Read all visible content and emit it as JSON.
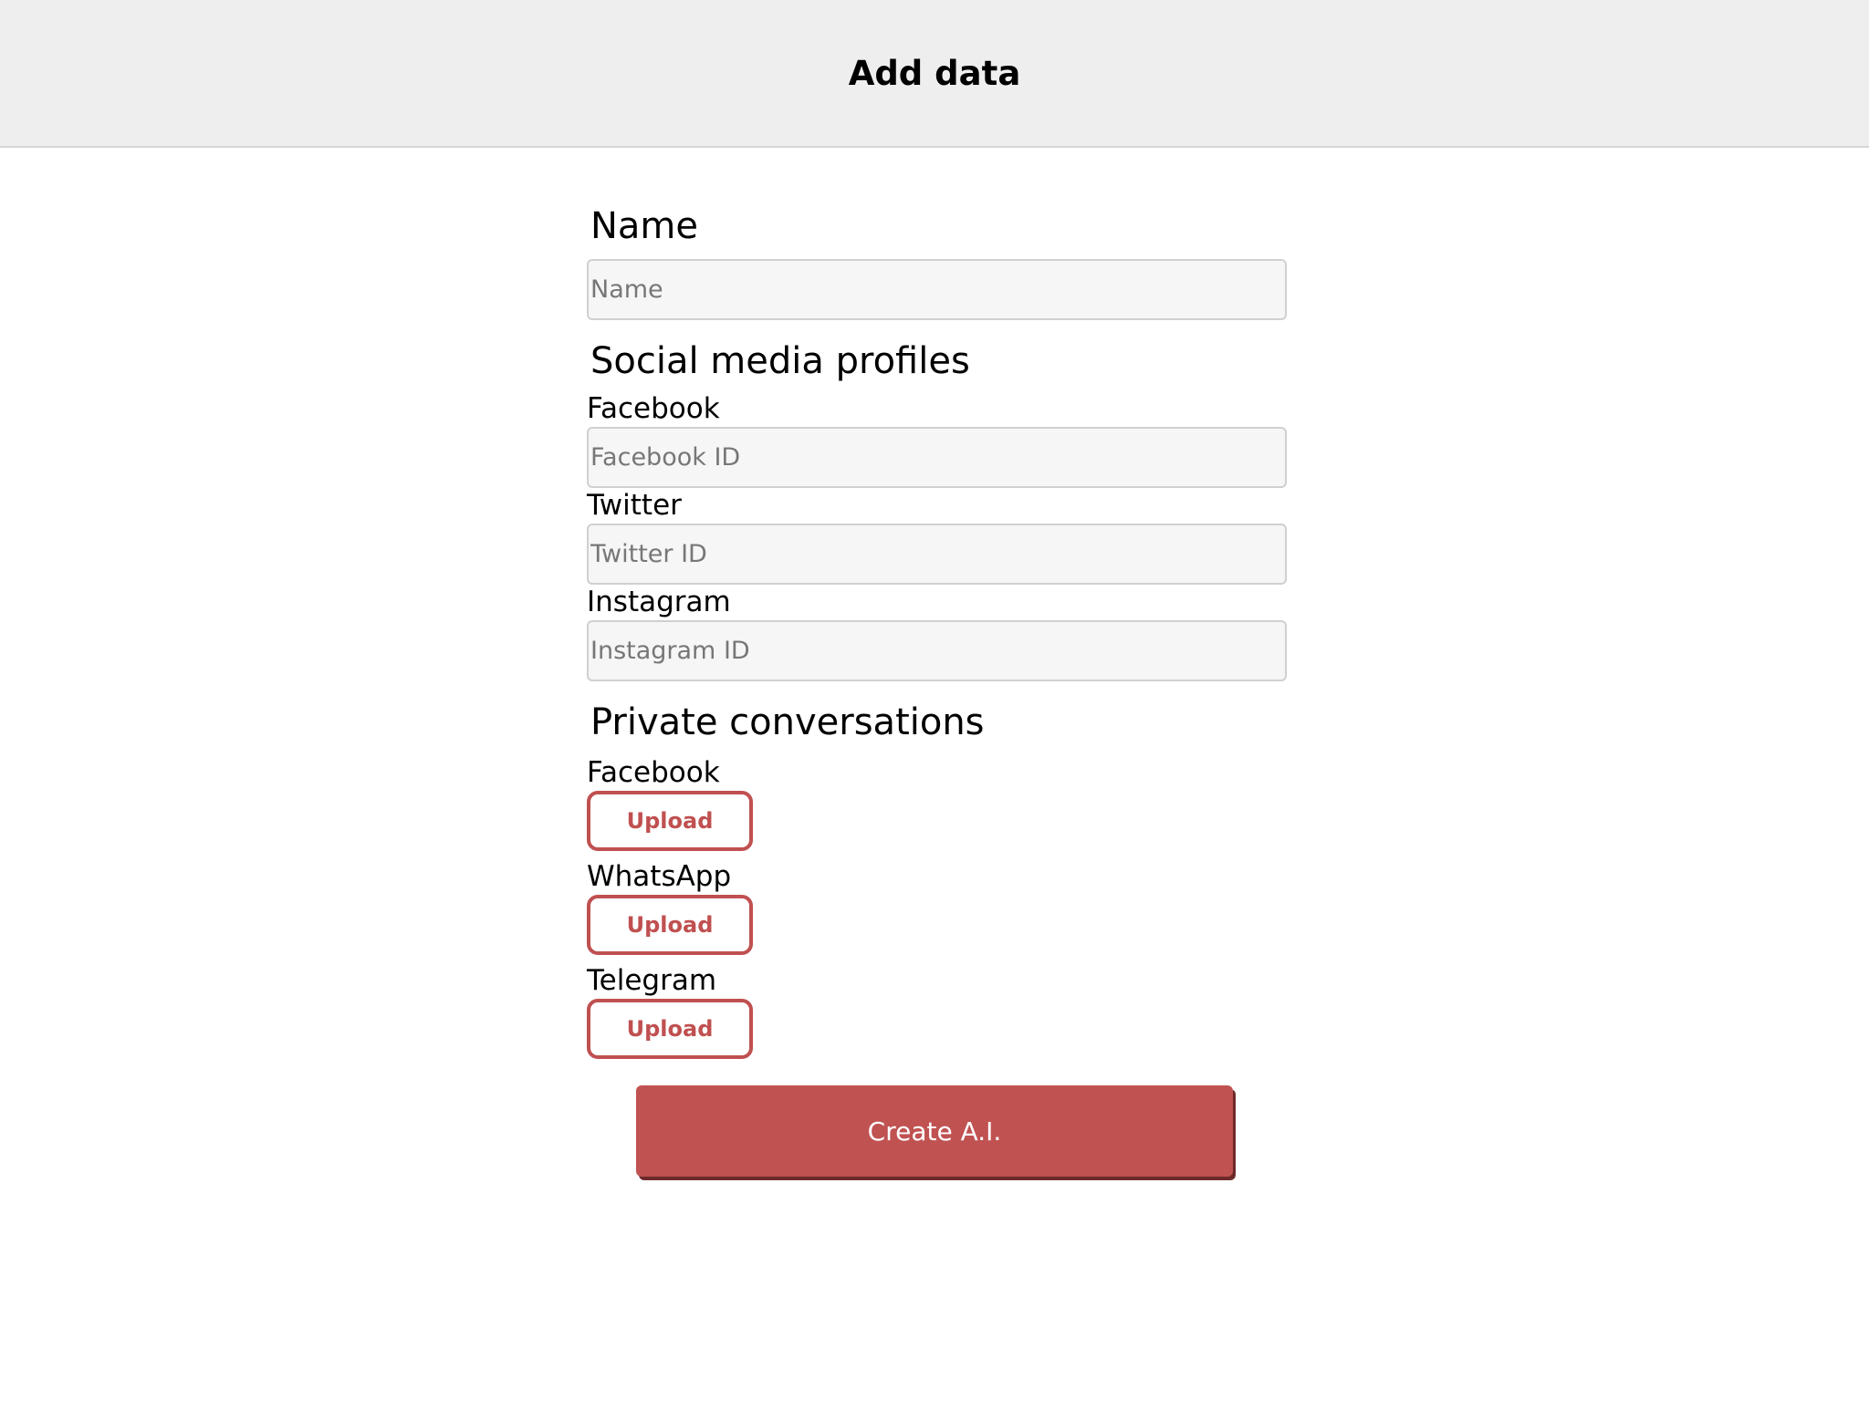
{
  "header": {
    "title": "Add data"
  },
  "name_section": {
    "heading": "Name",
    "placeholder": "Name"
  },
  "social": {
    "heading": "Social media profiles",
    "facebook_label": "Facebook",
    "facebook_placeholder": "Facebook ID",
    "twitter_label": "Twitter",
    "twitter_placeholder": "Twitter ID",
    "instagram_label": "Instagram",
    "instagram_placeholder": "Instagram ID"
  },
  "private": {
    "heading": "Private conversations",
    "items": [
      {
        "label": "Facebook",
        "button": "Upload"
      },
      {
        "label": "WhatsApp",
        "button": "Upload"
      },
      {
        "label": "Telegram",
        "button": "Upload"
      }
    ]
  },
  "actions": {
    "create_label": "Create A.I."
  },
  "colors": {
    "accent": "#c05252",
    "header_bg": "#eeeeee",
    "input_bg": "#f6f6f6"
  }
}
